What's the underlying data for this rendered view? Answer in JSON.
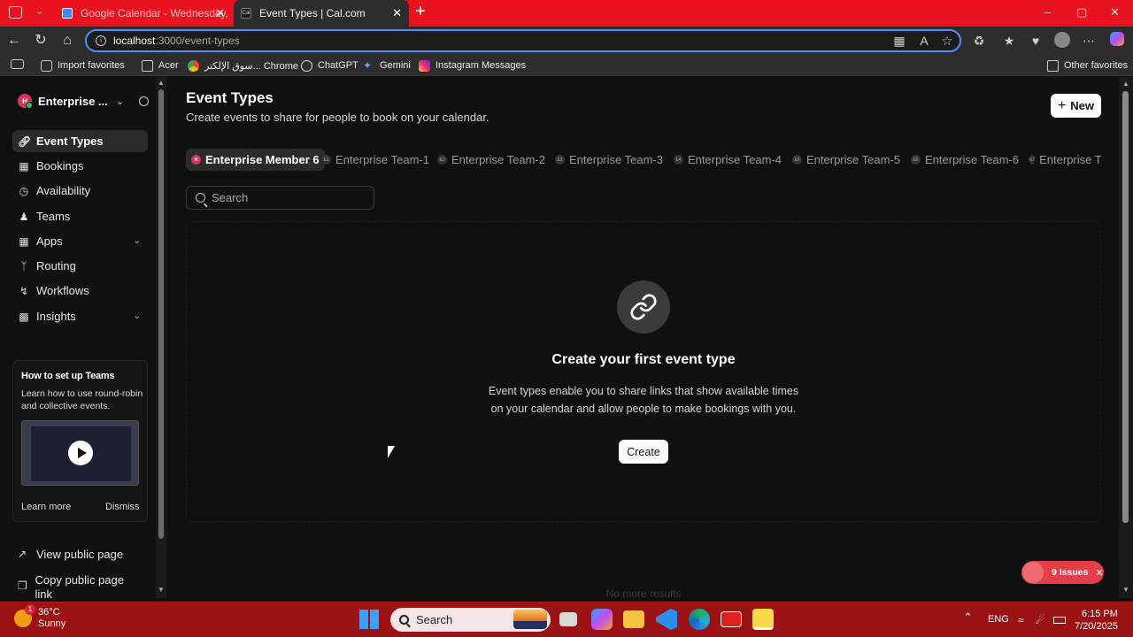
{
  "browser": {
    "tabs": [
      {
        "title": "Google Calendar - Wednesday, Ju",
        "active": false
      },
      {
        "title": "Event Types | Cal.com",
        "active": true
      }
    ],
    "url_host": "localhost",
    "url_path": ":3000/event-types",
    "bookmarks": [
      "Import favorites",
      "Acer",
      "سوق الإلكتر... Chrome",
      "ChatGPT",
      "Gemini",
      "Instagram Messages",
      "Other favorites"
    ]
  },
  "sidebar": {
    "org_name": "Enterprise ...",
    "org_initial": "H",
    "items": [
      {
        "label": "Event Types",
        "icon": "link-icon",
        "active": true
      },
      {
        "label": "Bookings",
        "icon": "calendar-icon"
      },
      {
        "label": "Availability",
        "icon": "clock-icon"
      },
      {
        "label": "Teams",
        "icon": "users-icon"
      },
      {
        "label": "Apps",
        "icon": "grid-icon",
        "expandable": true
      },
      {
        "label": "Routing",
        "icon": "split-icon"
      },
      {
        "label": "Workflows",
        "icon": "zap-icon"
      },
      {
        "label": "Insights",
        "icon": "bar-chart-icon",
        "expandable": true
      }
    ],
    "promo": {
      "title": "How to set up Teams",
      "description": "Learn how to use round-robin and collective events.",
      "learn_more": "Learn more",
      "dismiss": "Dismiss"
    },
    "bottom_links": [
      {
        "label": "View public page",
        "icon": "external-link-icon"
      },
      {
        "label": "Copy public page link",
        "icon": "copy-icon"
      }
    ]
  },
  "main": {
    "title": "Event Types",
    "subtitle": "Create events to share for people to book on your calendar.",
    "new_button": "New",
    "team_tabs": [
      {
        "label": "Enterprise Member 6",
        "badge": "H",
        "active": true
      },
      {
        "label": "Enterprise Team-1",
        "badge": "E1"
      },
      {
        "label": "Enterprise Team-2",
        "badge": "E2"
      },
      {
        "label": "Enterprise Team-3",
        "badge": "E3"
      },
      {
        "label": "Enterprise Team-4",
        "badge": "E4"
      },
      {
        "label": "Enterprise Team-5",
        "badge": "E5"
      },
      {
        "label": "Enterprise Team-6",
        "badge": "E6"
      },
      {
        "label": "Enterprise T",
        "badge": "E7"
      }
    ],
    "search_placeholder": "Search",
    "empty_state": {
      "title": "Create your first event type",
      "description": "Event types enable you to share links that show available times on your calendar and allow people to make bookings with you.",
      "button": "Create"
    },
    "footer_text": "No more results",
    "issues_label": "9 Issues"
  },
  "taskbar": {
    "weather_temp": "36°C",
    "weather_desc": "Sunny",
    "weather_badge": "1",
    "search_label": "Search",
    "language": "ENG",
    "time": "6:15 PM",
    "date": "7/20/2025"
  },
  "colors": {
    "browser_accent": "#e8131f",
    "taskbar": "#9a1214",
    "app_background": "#101010",
    "issues_badge": "#e53e4b",
    "avatar": "#d8335f"
  }
}
